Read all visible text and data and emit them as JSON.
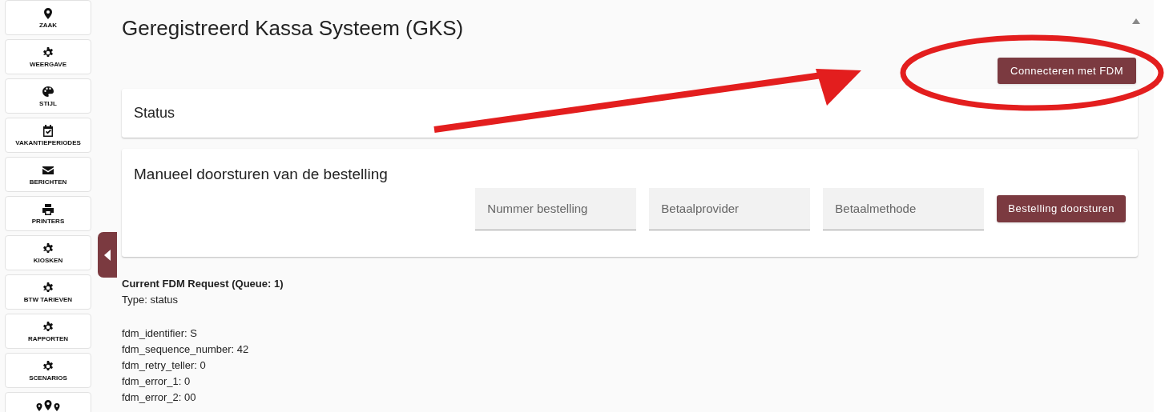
{
  "sidebar": {
    "items": [
      {
        "label": "ZAAK"
      },
      {
        "label": "WEERGAVE"
      },
      {
        "label": "STIJL"
      },
      {
        "label": "VAKANTIEPERIODES"
      },
      {
        "label": "BERICHTEN"
      },
      {
        "label": "PRINTERS"
      },
      {
        "label": "KIOSKEN"
      },
      {
        "label": "BTW TARIEVEN"
      },
      {
        "label": "RAPPORTEN"
      },
      {
        "label": "SCENARIOS"
      }
    ]
  },
  "page": {
    "title": "Geregistreerd Kassa Systeem (GKS)",
    "connect_button": "Connecteren met FDM"
  },
  "status_card": {
    "title": "Status"
  },
  "manual_card": {
    "title": "Manueel doorsturen van de bestelling",
    "fields": [
      {
        "placeholder": "Nummer bestelling"
      },
      {
        "placeholder": "Betaalprovider"
      },
      {
        "placeholder": "Betaalmethode"
      }
    ],
    "button": "Bestelling doorsturen"
  },
  "request": {
    "heading": "Current FDM Request (Queue: 1)",
    "type": "Type: status",
    "lines": [
      "fdm_identifier: S",
      "fdm_sequence_number: 42",
      "fdm_retry_teller: 0",
      "fdm_error_1: 0",
      "fdm_error_2: 00"
    ]
  }
}
